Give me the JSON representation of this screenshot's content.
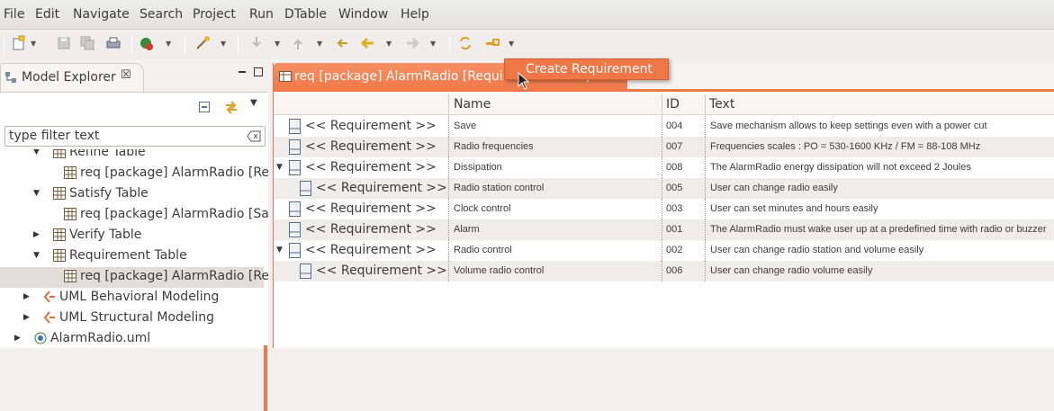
{
  "menu": [
    "File",
    "Edit",
    "Navigate",
    "Search",
    "Project",
    "Run",
    "DTable",
    "Window",
    "Help"
  ],
  "model_explorer": {
    "title": "Model Explorer",
    "close_glyph": "☒",
    "filter_placeholder": "type filter text",
    "tree": [
      {
        "label": "Refine Table",
        "level": 2,
        "expander": "▼",
        "icon": "table-icon"
      },
      {
        "label": "req [package] AlarmRadio [Refine",
        "level": 3,
        "expander": "",
        "icon": "table-icon"
      },
      {
        "label": "Satisfy Table",
        "level": 2,
        "expander": "▼",
        "icon": "table-icon"
      },
      {
        "label": "req [package] AlarmRadio [Satisf",
        "level": 3,
        "expander": "",
        "icon": "table-icon"
      },
      {
        "label": "Verify Table",
        "level": 2,
        "expander": "▶",
        "icon": "table-icon"
      },
      {
        "label": "Requirement Table",
        "level": 2,
        "expander": "▼",
        "icon": "table-icon"
      },
      {
        "label": "req [package] AlarmRadio [Requ",
        "level": 3,
        "expander": "",
        "icon": "table-icon",
        "selected": true
      },
      {
        "label": "UML Behavioral Modeling",
        "level": 1,
        "expander": "▶",
        "icon": "uml-icon"
      },
      {
        "label": "UML Structural Modeling",
        "level": 1,
        "expander": "▶",
        "icon": "uml-icon"
      },
      {
        "label": "AlarmRadio.uml",
        "level": 0,
        "expander": "▶",
        "icon": "uml-file-icon"
      }
    ]
  },
  "editor": {
    "tab_label": "req [package] AlarmRadio [Requirement Table]",
    "columns": [
      "Name",
      "ID",
      "Text"
    ],
    "rows": [
      {
        "header": "<< Requirement >>",
        "name": "Save",
        "id": "004",
        "text": "Save mechanism allows to keep settings even with a power cut",
        "expander": "",
        "indent": 0
      },
      {
        "header": "<< Requirement >>",
        "name": "Radio frequencies",
        "id": "007",
        "text": "Frequencies scales : PO = 530-1600 KHz / FM = 88-108 MHz",
        "expander": "",
        "indent": 0
      },
      {
        "header": "<< Requirement >>",
        "name": "Dissipation",
        "id": "008",
        "text": "The AlarmRadio energy dissipation will not exceed 2 Joules",
        "expander": "▼",
        "indent": 0
      },
      {
        "header": "<< Requirement >>",
        "name": "Radio station control",
        "id": "005",
        "text": "User can change radio easily",
        "expander": "",
        "indent": 1
      },
      {
        "header": "<< Requirement >>",
        "name": "Clock control",
        "id": "003",
        "text": "User can set minutes and hours easily",
        "expander": "",
        "indent": 0
      },
      {
        "header": "<< Requirement >>",
        "name": "Alarm",
        "id": "001",
        "text": "The AlarmRadio must wake user up at a predefined time with radio or buzzer",
        "expander": "",
        "indent": 0
      },
      {
        "header": "<< Requirement >>",
        "name": "Radio control",
        "id": "002",
        "text": "User can change radio station and volume easily",
        "expander": "▼",
        "indent": 0
      },
      {
        "header": "<< Requirement >>",
        "name": "Volume radio control",
        "id": "006",
        "text": "User can change radio volume easily",
        "expander": "",
        "indent": 1
      }
    ]
  },
  "context_popup": {
    "label": "Create Requirement"
  },
  "colors": {
    "accent": "#f07746",
    "selection": "#e0ddda"
  }
}
